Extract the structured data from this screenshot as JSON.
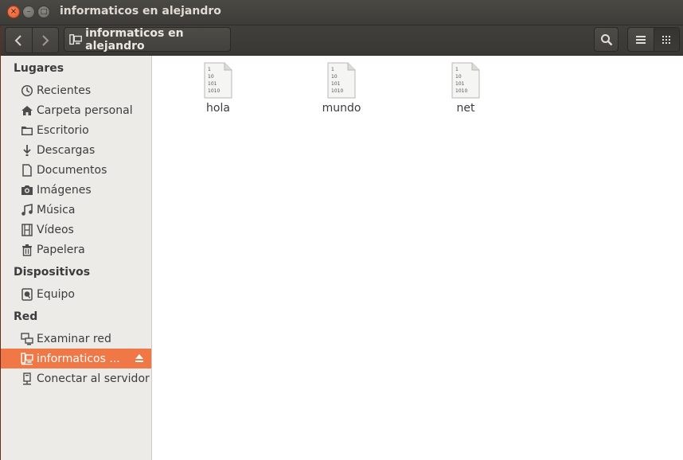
{
  "window": {
    "title": "informaticos en alejandro",
    "close_glyph": "×",
    "min_glyph": "–",
    "max_glyph": "□"
  },
  "toolbar": {
    "back_icon": "chevron-left-icon",
    "forward_icon": "chevron-right-icon",
    "path_label": "informaticos en alejandro",
    "search_icon": "search-icon",
    "list_view_icon": "list-view-icon",
    "grid_view_icon": "grid-view-icon"
  },
  "sidebar": {
    "sections": [
      {
        "header": "Lugares",
        "items": [
          {
            "label": "Recientes",
            "icon": "clock-icon"
          },
          {
            "label": "Carpeta personal",
            "icon": "home-icon"
          },
          {
            "label": "Escritorio",
            "icon": "folder-icon"
          },
          {
            "label": "Descargas",
            "icon": "download-icon"
          },
          {
            "label": "Documentos",
            "icon": "document-icon"
          },
          {
            "label": "Imágenes",
            "icon": "camera-icon"
          },
          {
            "label": "Música",
            "icon": "music-icon"
          },
          {
            "label": "Vídeos",
            "icon": "film-icon"
          },
          {
            "label": "Papelera",
            "icon": "trash-icon"
          }
        ]
      },
      {
        "header": "Dispositivos",
        "items": [
          {
            "label": "Equipo",
            "icon": "drive-icon"
          }
        ]
      },
      {
        "header": "Red",
        "items": [
          {
            "label": "Examinar red",
            "icon": "network-icon"
          },
          {
            "label": "informaticos ...",
            "icon": "network-share-icon",
            "selected": true
          },
          {
            "label": "Conectar al servidor",
            "icon": "server-icon"
          }
        ]
      }
    ]
  },
  "files": [
    {
      "name": "hola",
      "icon": "binary-file-icon",
      "icon_text": [
        "1",
        "10",
        "101",
        "1010"
      ]
    },
    {
      "name": "mundo",
      "icon": "binary-file-icon",
      "icon_text": [
        "1",
        "10",
        "101",
        "1010"
      ]
    },
    {
      "name": "net",
      "icon": "binary-file-icon",
      "icon_text": [
        "1",
        "10",
        "101",
        "1010"
      ]
    }
  ],
  "colors": {
    "accent": "#f07746",
    "titlebar": "#3d3c38",
    "sidebar_bg": "#edebe8"
  }
}
